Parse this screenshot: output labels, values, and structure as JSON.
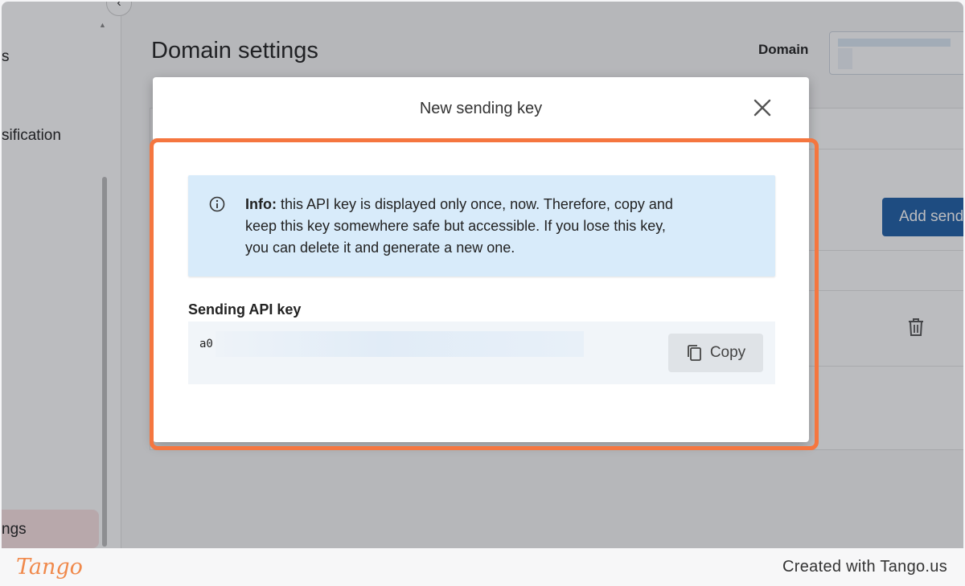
{
  "sidebar": {
    "items": [
      {
        "label": "s"
      },
      {
        "label": "sification"
      },
      {
        "label": "ngs"
      }
    ]
  },
  "page": {
    "title": "Domain settings",
    "domain_label": "Domain",
    "add_button_label": "Add send"
  },
  "modal": {
    "title": "New sending key",
    "info_label": "Info:",
    "info_text": " this API key is displayed only once, now. Therefore, copy and keep this key somewhere safe but accessible. If you lose this key, you can delete it and generate a new one.",
    "key_label": "Sending API key",
    "key_prefix": "a0",
    "copy_label": "Copy"
  },
  "footer": {
    "brand": "Tango",
    "credit": "Created with Tango.us"
  },
  "colors": {
    "highlight": "#f5763f",
    "info_bg": "#d8ebfa",
    "primary_button": "#1f5fa6",
    "brand": "#f0894b"
  },
  "icons": [
    "chevron-left-icon",
    "chevron-up-icon",
    "close-icon",
    "info-icon",
    "copy-icon",
    "trash-icon"
  ]
}
